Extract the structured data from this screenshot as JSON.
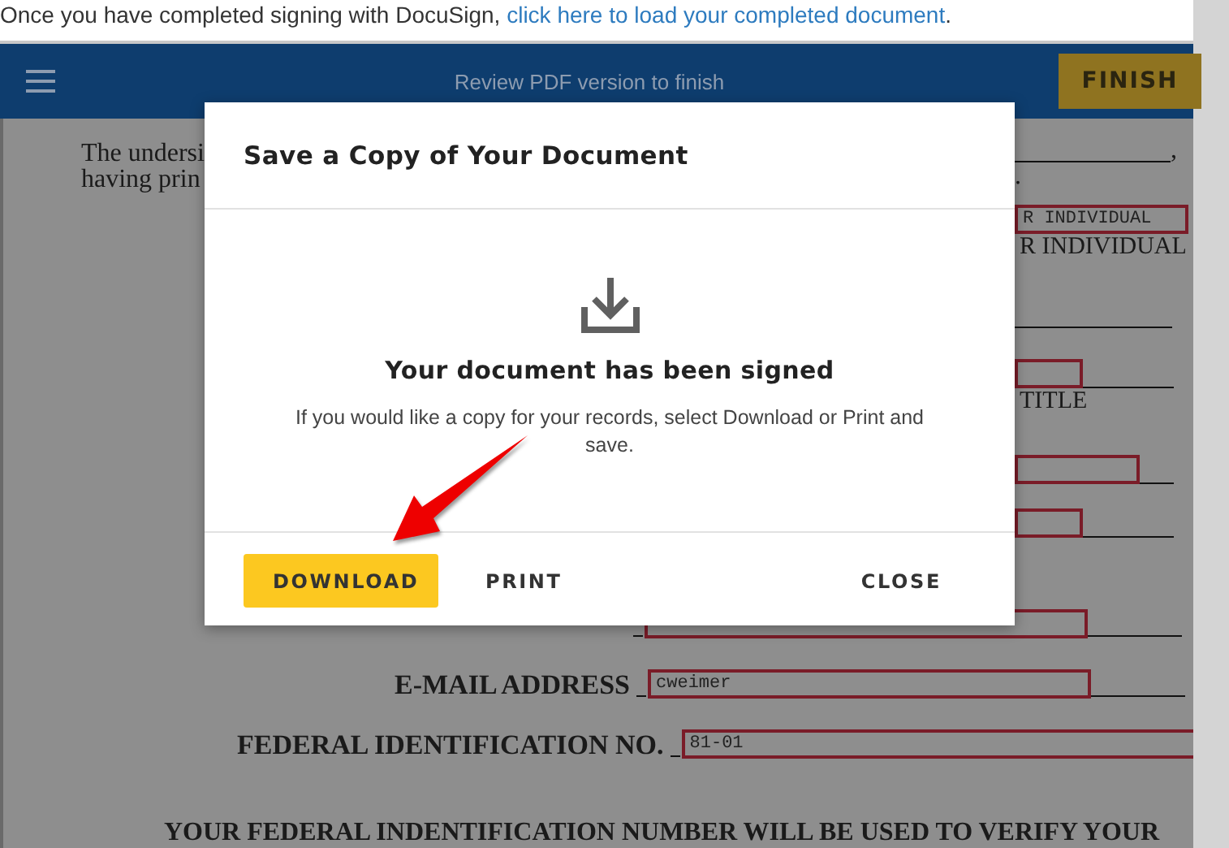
{
  "notice": {
    "text": "Once you have completed signing with DocuSign, ",
    "link": "click here to load your completed document",
    "trail": "."
  },
  "header": {
    "title": "Review PDF version to finish",
    "finish_button": "FINISH"
  },
  "document": {
    "intro_lines": [
      {
        "text": "The undersi",
        "trail": ","
      },
      {
        "text": "having prin",
        "trail": "."
      }
    ],
    "right_column": [
      {
        "kind": "field",
        "value": "R INDIVIDUAL"
      },
      {
        "kind": "caption",
        "text": "R INDIVIDUAL"
      },
      {
        "kind": "rule"
      },
      {
        "kind": "field"
      },
      {
        "kind": "caption",
        "text": "TITLE"
      },
      {
        "kind": "field"
      },
      {
        "kind": "field"
      }
    ],
    "rows": [
      {},
      {
        "label": "E-MAIL ADDRESS",
        "value": "cweimer"
      },
      {
        "label": "FEDERAL IDENTIFICATION NO.",
        "value": "81-01"
      }
    ],
    "statement": "YOUR FEDERAL INDENTIFICATION NUMBER WILL BE USED TO VERIFY YOUR"
  },
  "dialog": {
    "title": "Save a Copy of Your Document",
    "heading": "Your document has been signed",
    "message": "If you would like a copy for your records, select Download or Print and save.",
    "buttons": [
      {
        "label": "DOWNLOAD",
        "kind": "primary"
      },
      {
        "label": "PRINT",
        "kind": "text"
      },
      {
        "label": "CLOSE",
        "kind": "close"
      }
    ]
  }
}
